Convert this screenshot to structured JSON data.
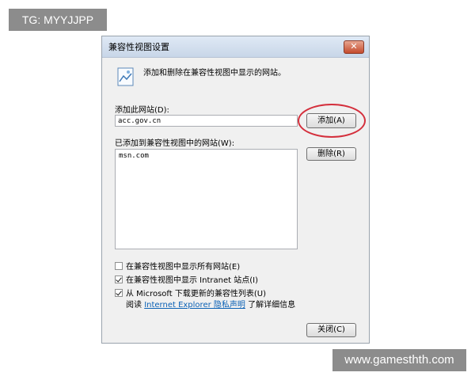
{
  "watermark_top": "TG: MYYJJPP",
  "watermark_bottom": "www.gamesthth.com",
  "dialog": {
    "title": "兼容性视图设置",
    "close_label": "✕",
    "description": "添加和删除在兼容性视图中显示的网站。",
    "add_site_label": "添加此网站(D):",
    "add_site_value": "acc.gov.cn",
    "add_button": "添加(A)",
    "added_sites_label": "已添加到兼容性视图中的网站(W):",
    "added_sites": [
      "msn.com"
    ],
    "remove_button": "删除(R)",
    "checkboxes": [
      {
        "label": "在兼容性视图中显示所有网站(E)",
        "checked": false
      },
      {
        "label": "在兼容性视图中显示 Intranet 站点(I)",
        "checked": true
      },
      {
        "label": "从 Microsoft 下载更新的兼容性列表(U)",
        "checked": true
      }
    ],
    "read_prefix": "阅读",
    "read_link": "Internet Explorer 隐私声明",
    "read_suffix": "了解详细信息",
    "close_button": "关闭(C)"
  },
  "colors": {
    "highlight": "#d42f3c",
    "link": "#0b61b5"
  }
}
